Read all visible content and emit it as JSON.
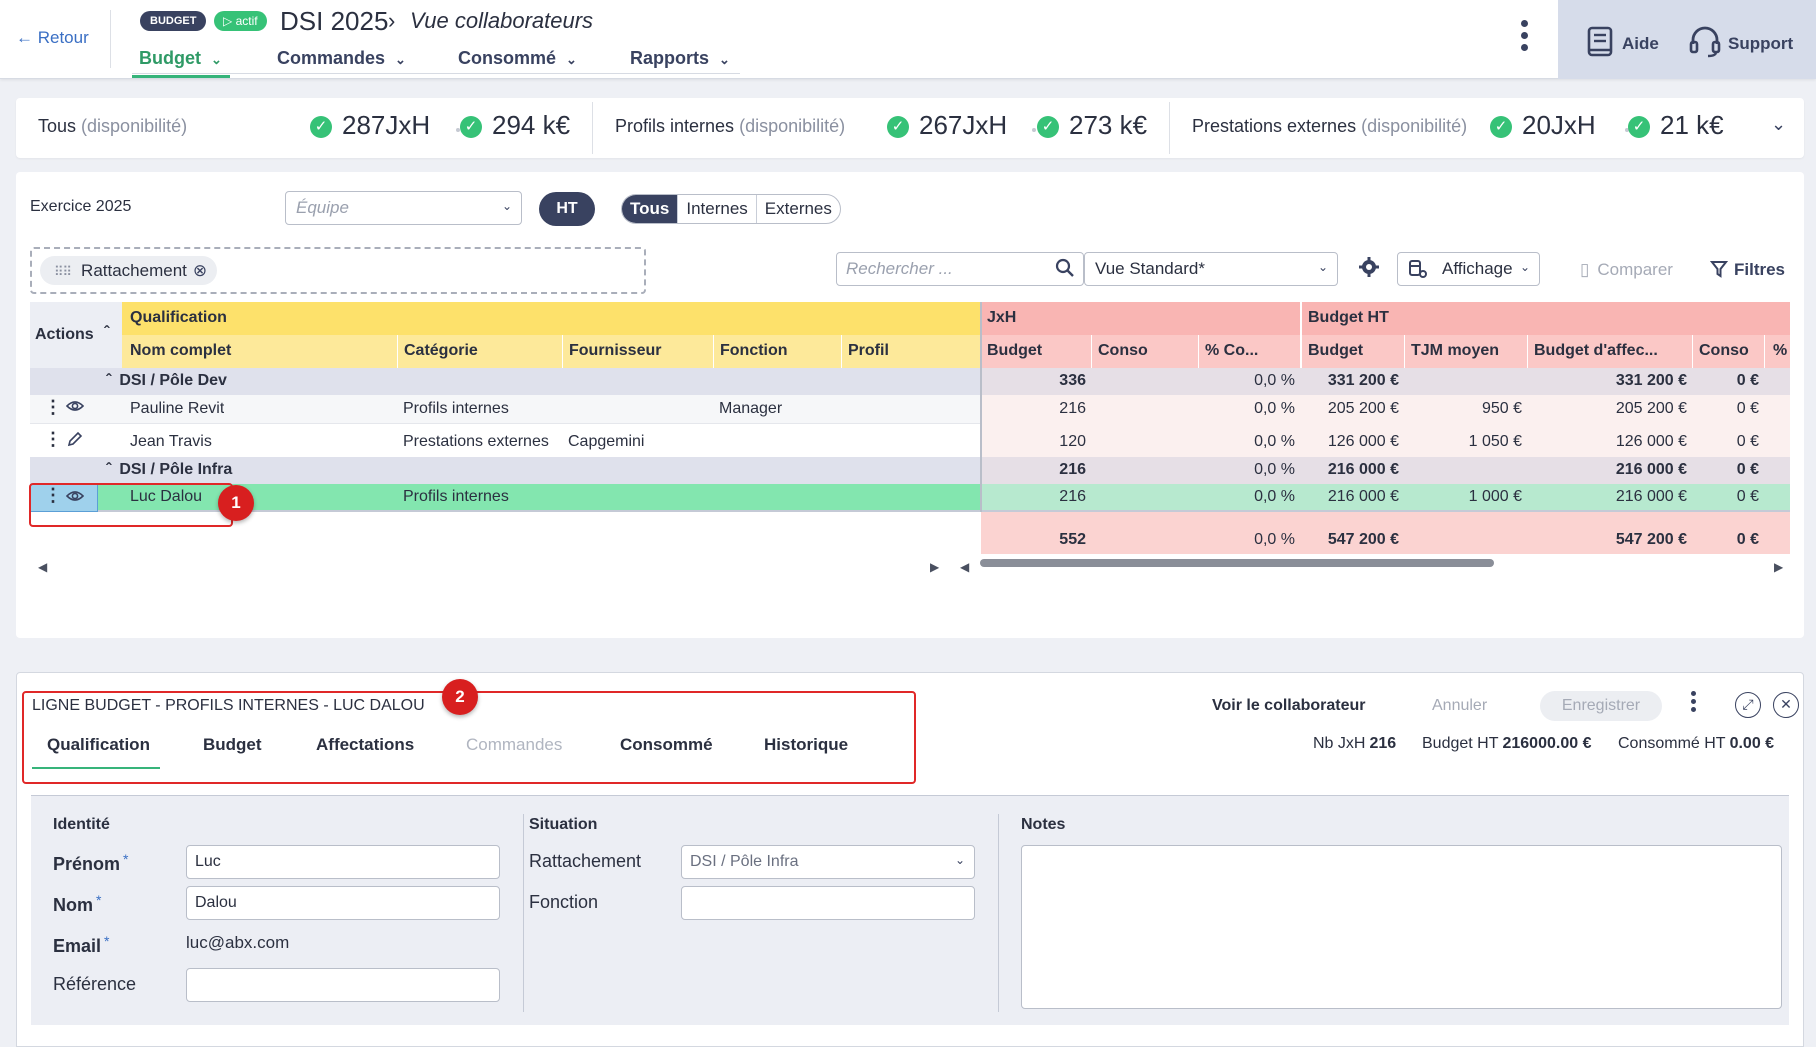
{
  "header": {
    "back_label": "← Retour",
    "badge_budget": "BUDGET",
    "badge_status": "▷ actif",
    "title": "DSI 2025",
    "subtitle": "Vue collaborateurs",
    "nav": [
      "Budget",
      "Commandes",
      "Consommé",
      "Rapports"
    ],
    "help": "Aide",
    "support": "Support"
  },
  "summary": {
    "groups": [
      {
        "label": "Tous",
        "muted": "(disponibilité)",
        "jxh": "287JxH",
        "keur": "294 k€"
      },
      {
        "label": "Profils internes",
        "muted": "(disponibilité)",
        "jxh": "267JxH",
        "keur": "273 k€"
      },
      {
        "label": "Prestations externes",
        "muted": "(disponibilité)",
        "jxh": "20JxH",
        "keur": "21 k€"
      }
    ]
  },
  "toolbar": {
    "exercice": "Exercice 2025",
    "equipe_placeholder": "Équipe",
    "ht": "HT",
    "filters": [
      "Tous",
      "Internes",
      "Externes"
    ],
    "chip": "Rattachement",
    "search_placeholder": "Rechercher ...",
    "vue": "Vue Standard*",
    "affichage": "Affichage",
    "comparer": "Comparer",
    "filtres": "Filtres"
  },
  "table": {
    "actions_header": "Actions",
    "group_qualification": "Qualification",
    "group_jxh": "JxH",
    "group_budget": "Budget HT",
    "columns": [
      "Nom complet",
      "Catégorie",
      "Fournisseur",
      "Fonction",
      "Profil",
      "Budget",
      "Conso",
      "% Co...",
      "Budget",
      "TJM moyen",
      "Budget d'affec...",
      "Conso",
      "%"
    ],
    "groups": [
      {
        "name": "DSI / Pôle Dev",
        "jxh_budget": "336",
        "pct": "0,0 %",
        "budget": "331 200 €",
        "affec": "331 200 €",
        "conso": "0 €"
      },
      {
        "name": "DSI / Pôle Infra",
        "jxh_budget": "216",
        "pct": "0,0 %",
        "budget": "216 000 €",
        "affec": "216 000 €",
        "conso": "0 €"
      }
    ],
    "rows": [
      {
        "nom": "Pauline Revit",
        "categorie": "Profils internes",
        "fournisseur": "",
        "fonction": "Manager",
        "jxh_budget": "216",
        "pct": "0,0 %",
        "budget": "205 200 €",
        "tjm": "950 €",
        "affec": "205 200 €",
        "conso": "0 €"
      },
      {
        "nom": "Jean Travis",
        "categorie": "Prestations externes",
        "fournisseur": "Capgemini",
        "fonction": "",
        "jxh_budget": "120",
        "pct": "0,0 %",
        "budget": "126 000 €",
        "tjm": "1 050 €",
        "affec": "126 000 €",
        "conso": "0 €"
      },
      {
        "nom": "Luc Dalou",
        "categorie": "Profils internes",
        "fournisseur": "",
        "fonction": "",
        "jxh_budget": "216",
        "pct": "0,0 %",
        "budget": "216 000 €",
        "tjm": "1 000 €",
        "affec": "216 000 €",
        "conso": "0 €"
      }
    ],
    "total": {
      "jxh_budget": "552",
      "pct": "0,0 %",
      "budget": "547 200 €",
      "affec": "547 200 €",
      "conso": "0 €"
    }
  },
  "detail": {
    "title": "LIGNE BUDGET - PROFILS INTERNES - LUC DALOU",
    "tabs": [
      "Qualification",
      "Budget",
      "Affectations",
      "Commandes",
      "Consommé",
      "Historique"
    ],
    "voir": "Voir le collaborateur",
    "annuler": "Annuler",
    "enregistrer": "Enregistrer",
    "stats": [
      {
        "label": "Nb JxH",
        "value": "216"
      },
      {
        "label": "Budget HT",
        "value": "216000.00 €"
      },
      {
        "label": "Consommé HT",
        "value": "0.00 €"
      }
    ],
    "identite": "Identité",
    "prenom_label": "Prénom",
    "prenom": "Luc",
    "nom_label": "Nom",
    "nom": "Dalou",
    "email_label": "Email",
    "email": "luc@abx.com",
    "reference_label": "Référence",
    "situation": "Situation",
    "rattachement_label": "Rattachement",
    "rattachement": "DSI / Pôle Infra",
    "fonction_label": "Fonction",
    "notes": "Notes",
    "required_mark": "*"
  },
  "annotations": [
    "1",
    "2"
  ]
}
